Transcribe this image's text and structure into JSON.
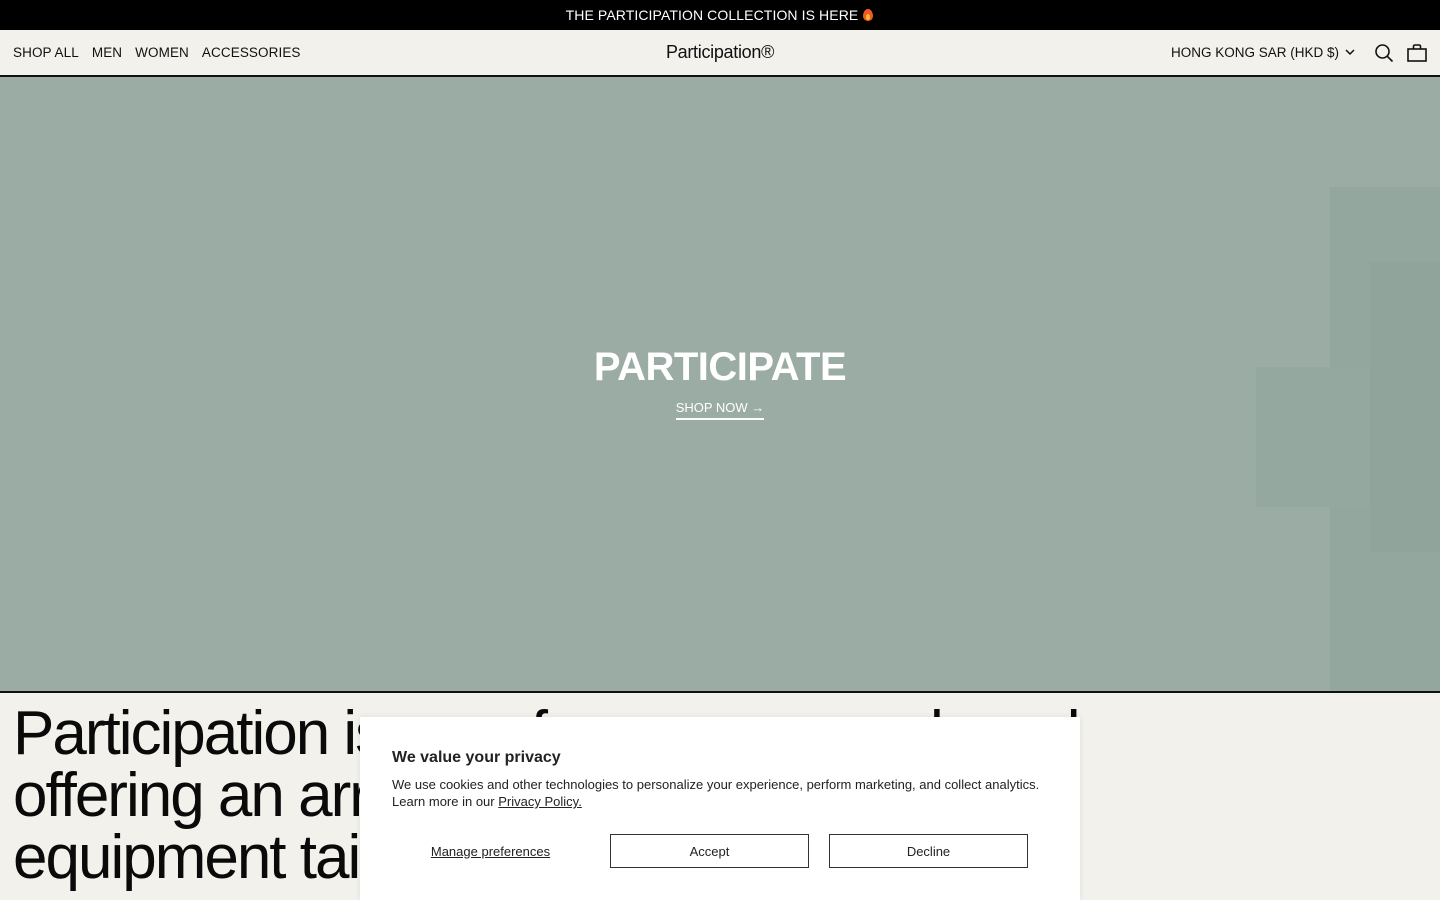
{
  "announcement": {
    "text": "THE PARTICIPATION COLLECTION IS HERE",
    "icon": "fire-icon"
  },
  "header": {
    "nav": [
      {
        "label": "SHOP ALL"
      },
      {
        "label": "MEN"
      },
      {
        "label": "WOMEN"
      },
      {
        "label": "ACCESSORIES"
      }
    ],
    "logo": "Participation®",
    "currency": "HONG KONG SAR (HKD $)",
    "icons": [
      "chevron-down-icon",
      "search-icon",
      "bag-icon"
    ]
  },
  "hero": {
    "title": "PARTICIPATE",
    "cta": "SHOP NOW →",
    "background_color": "#9aaca3"
  },
  "about": {
    "lines": [
      "Participation is a performance wear brand",
      "offering an array of apparel, footwear and",
      "equipment tailored for athletes seeking"
    ]
  },
  "cookie_banner": {
    "title": "We value your privacy",
    "body": "We use cookies and other technologies to personalize your experience, perform marketing, and collect analytics. Learn more in our",
    "link": "Privacy Policy.",
    "manage_label": "Manage preferences",
    "accept_label": "Accept",
    "decline_label": "Decline"
  }
}
